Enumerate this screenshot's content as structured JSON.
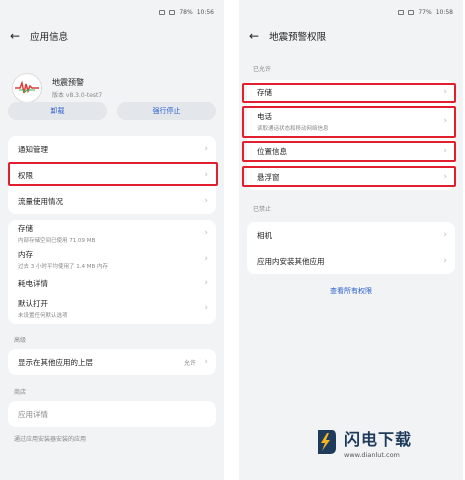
{
  "left": {
    "status_battery": "78%",
    "status_time": "10:56",
    "header_title": "应用信息",
    "app_name": "地震预警",
    "app_version": "版本 v8.3.0-test7",
    "btn_uninstall": "卸载",
    "btn_force_stop": "强行停止",
    "card1": [
      "通知管理",
      "权限",
      "流量使用情况"
    ],
    "storage_title": "存储",
    "storage_sub": "内部存储空间已使用 71.09 MB",
    "memory_title": "内存",
    "memory_sub": "过去 3 小时平均使用了 1.4 MB 内存",
    "battery_title": "耗电详情",
    "default_open_title": "默认打开",
    "default_open_sub": "未设置任何默认选项",
    "advanced_label": "高级",
    "overlay_title": "显示在其他应用的上层",
    "overlay_value": "允许",
    "store_label": "商店",
    "app_details": "应用详情",
    "install_source": "通过应用安装器安装的应用"
  },
  "right": {
    "status_battery": "77%",
    "status_time": "10:58",
    "header_title": "地震预警权限",
    "allowed_label": "已允许",
    "allowed": [
      {
        "title": "存储",
        "sub": ""
      },
      {
        "title": "电话",
        "sub": "读取通话状态和移动网络信息"
      },
      {
        "title": "位置信息",
        "sub": ""
      },
      {
        "title": "悬浮窗",
        "sub": ""
      }
    ],
    "denied_label": "已禁止",
    "denied": [
      "相机",
      "应用内安装其他应用"
    ],
    "view_all": "查看所有权限"
  },
  "watermark": {
    "title": "闪电下载",
    "url": "www.dianlut.com"
  },
  "colors": {
    "highlight": "#e0202e",
    "link": "#2a5fcf",
    "background": "#f1f3f5"
  }
}
